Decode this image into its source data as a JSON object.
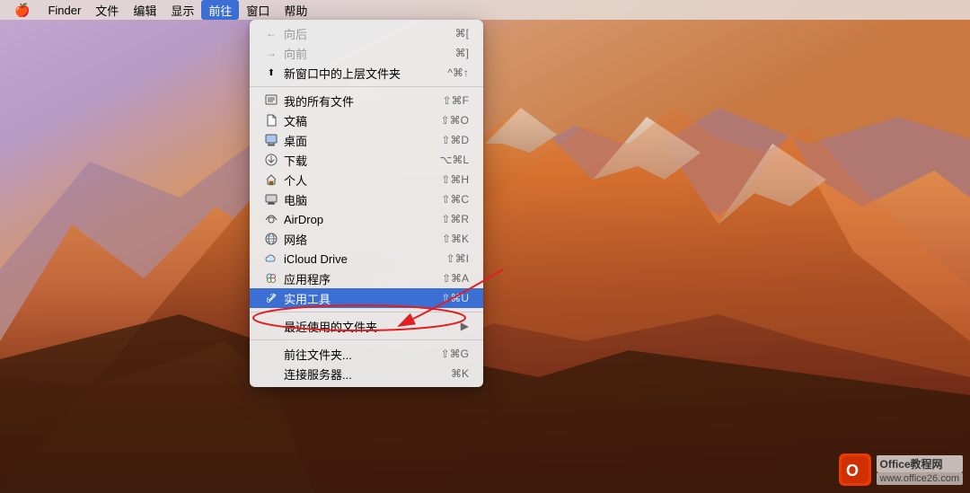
{
  "menubar": {
    "apple": "🍎",
    "items": [
      {
        "label": "Finder",
        "active": false
      },
      {
        "label": "文件",
        "active": false
      },
      {
        "label": "编辑",
        "active": false
      },
      {
        "label": "显示",
        "active": false
      },
      {
        "label": "前往",
        "active": true
      },
      {
        "label": "窗口",
        "active": false
      },
      {
        "label": "帮助",
        "active": false
      }
    ]
  },
  "dropdown": {
    "items": [
      {
        "type": "item",
        "icon": "←",
        "label": "向后",
        "shortcut": "⌘[",
        "iconType": "back"
      },
      {
        "type": "item",
        "icon": "→",
        "label": "向前",
        "shortcut": "⌘]",
        "iconType": "forward"
      },
      {
        "type": "item",
        "icon": "",
        "label": "新窗口中的上层文件夹",
        "shortcut": "^⌘↑",
        "iconType": "up"
      },
      {
        "type": "separator"
      },
      {
        "type": "item",
        "icon": "≡",
        "label": "我的所有文件",
        "shortcut": "⇧⌘F",
        "iconType": "all-files"
      },
      {
        "type": "item",
        "icon": "📄",
        "label": "文稿",
        "shortcut": "⇧⌘O",
        "iconType": "documents"
      },
      {
        "type": "item",
        "icon": "🖥",
        "label": "桌面",
        "shortcut": "⇧⌘D",
        "iconType": "desktop"
      },
      {
        "type": "item",
        "icon": "⬇",
        "label": "下载",
        "shortcut": "⌥⌘L",
        "iconType": "downloads"
      },
      {
        "type": "item",
        "icon": "🏠",
        "label": "个人",
        "shortcut": "⇧⌘H",
        "iconType": "home"
      },
      {
        "type": "item",
        "icon": "💻",
        "label": "电脑",
        "shortcut": "⇧⌘C",
        "iconType": "computer"
      },
      {
        "type": "item",
        "icon": "📡",
        "label": "AirDrop",
        "shortcut": "⇧⌘R",
        "iconType": "airdrop"
      },
      {
        "type": "item",
        "icon": "🌐",
        "label": "网络",
        "shortcut": "⇧⌘K",
        "iconType": "network"
      },
      {
        "type": "item",
        "icon": "☁",
        "label": "iCloud Drive",
        "shortcut": "⇧⌘I",
        "iconType": "icloud"
      },
      {
        "type": "item",
        "icon": "🚀",
        "label": "应用程序",
        "shortcut": "⇧⌘A",
        "iconType": "applications"
      },
      {
        "type": "item",
        "icon": "🔧",
        "label": "实用工具",
        "shortcut": "⇧⌘U",
        "iconType": "utilities",
        "highlighted": true
      },
      {
        "type": "separator"
      },
      {
        "type": "item",
        "icon": "",
        "label": "最近使用的文件夹",
        "shortcut": "▶",
        "iconType": "recent",
        "hasArrow": true
      },
      {
        "type": "separator"
      },
      {
        "type": "item",
        "icon": "",
        "label": "前往文件夹...",
        "shortcut": "⇧⌘G",
        "iconType": "goto"
      },
      {
        "type": "item",
        "icon": "",
        "label": "连接服务器...",
        "shortcut": "⌘K",
        "iconType": "server"
      }
    ]
  },
  "watermark": {
    "logo": "O",
    "text": "Office教程网",
    "subtext": "www.office26.com"
  },
  "annotation": {
    "circle_label": "实用工具 highlighted"
  }
}
